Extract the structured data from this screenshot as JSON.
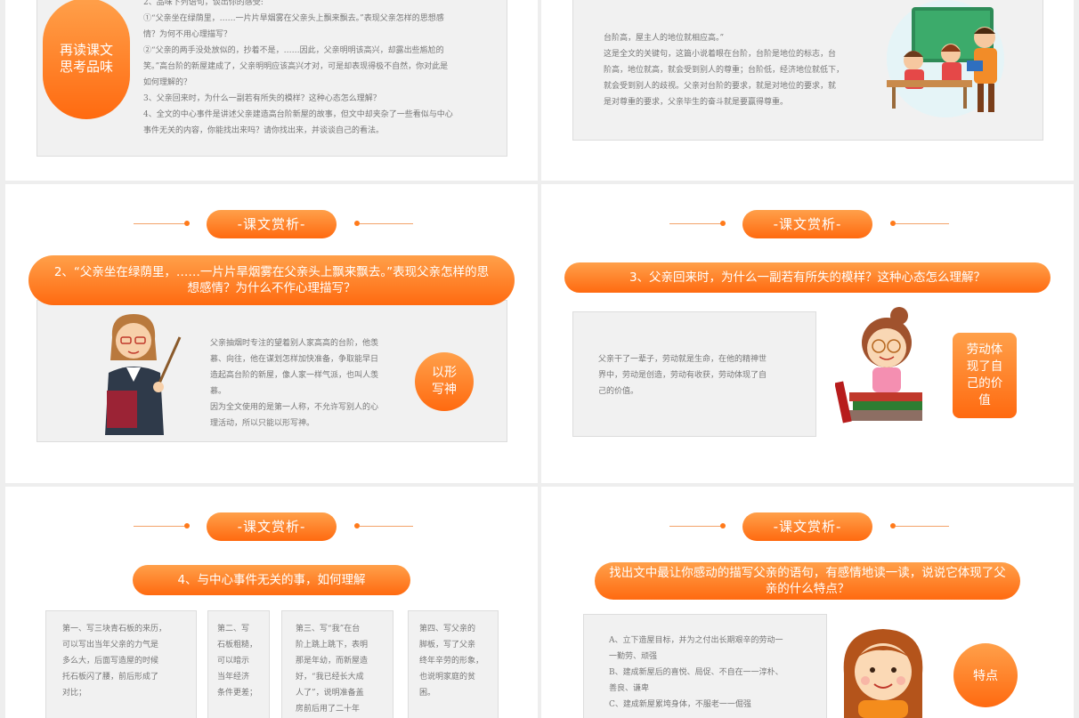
{
  "slide1": {
    "badge": "再读课文\n思考品味",
    "lines": [
      "2、品味下列语句，谈出你的感受:",
      "①“父亲坐在绿荫里，……一片片旱烟雾在父亲头上飘来飘去。”表现父亲怎样的思想感",
      "情？为何不用心理描写？",
      "②“父亲的两手没处放似的，抄着不是，……因此，父亲明明该高兴，却露出些尴尬的",
      "笑。”高台阶的新屋建成了，父亲明明应该高兴才对，可是却表现得极不自然，你对此是",
      "如何理解的？",
      "3、父亲回来时，为什么一副若有所失的模样？这种心态怎么理解？",
      "4、全文的中心事件是讲述父亲建造高台阶新屋的故事，但文中却夹杂了一些看似与中心",
      "事件无关的内容，你能找出来吗？请你找出来，并谈谈自己的看法。"
    ]
  },
  "slide2": {
    "lines": [
      "台阶高，屋主人的地位就相应高。”",
      "这是全文的关键句，这篇小说着眼在台阶，台阶是地位的标志，台",
      "阶高，地位就高，就会受到别人的尊重；台阶低，经济地位就低下，",
      "就会受到别人的歧视。父亲对台阶的要求，就是对地位的要求，就",
      "是对尊重的要求，父亲毕生的奋斗就是要赢得尊重。"
    ]
  },
  "slide3": {
    "title": "-课文赏析-",
    "banner": "2、“父亲坐在绿荫里，……一片片旱烟雾在父亲头上飘来飘去。”表现父亲怎样的思想感情？为什么不作心理描写？",
    "lines": [
      "父亲抽烟时专注的望着别人家高高的台阶，他羡",
      "慕、向往，他在谋划怎样加快准备，争取能早日",
      "造起高台阶的新屋，像人家一样气派，也叫人羡",
      "慕。",
      "因为全文使用的是第一人称，不允许写别人的心",
      "理活动，所以只能以形写神。"
    ],
    "circle": "以形\n写神"
  },
  "slide4": {
    "title": "-课文赏析-",
    "banner": "3、父亲回来时，为什么一副若有所失的模样？这种心态怎么理解？",
    "lines": [
      "父亲干了一辈子，劳动就是生命，在他的精神世",
      "界中，劳动是创造，劳动有收获，劳动体现了自",
      "己的价值。"
    ],
    "box": "劳动体\n现了自\n己的价\n值"
  },
  "slide5": {
    "title": "-课文赏析-",
    "banner": "4、与中心事件无关的事，如何理解",
    "col1": [
      "第一、写三块青石板的来历，",
      "可以写出当年父亲的力气是",
      "多么大，后面写造屋的时候",
      "托石板闪了腰，前后形成了",
      "对比；"
    ],
    "col2": [
      "第二、写",
      "石板粗糙，",
      "可以暗示",
      "当年经济",
      "条件更差；"
    ],
    "col3": [
      "第三、写“我”在台",
      "阶上跳上跳下，表明",
      "那是年幼，而新屋造",
      "好，“我已经长大成",
      "人了”，说明准备盖",
      "房前后用了二十年"
    ],
    "col4": [
      "第四、写父亲的",
      "脚板，写了父亲",
      "终年辛劳的形象，",
      "也说明家庭的贫",
      "困。"
    ]
  },
  "slide6": {
    "title": "-课文赏析-",
    "banner": "找出文中最让你感动的描写父亲的语句，有感情地读一读，说说它体现了父亲的什么特点？",
    "lines": [
      "A、立下造屋目标，并为之付出长期艰辛的劳动一",
      "一勤劳、顽强",
      "B、建成新屋后的喜悦、局促、不自在一一淳朴、",
      "善良、谦卑",
      "C、建成新屋累垮身体，不服老一一倔强"
    ],
    "circle": "特点"
  },
  "colors": {
    "accent": "#ff7a1a",
    "accent_light": "#ffa04a"
  }
}
